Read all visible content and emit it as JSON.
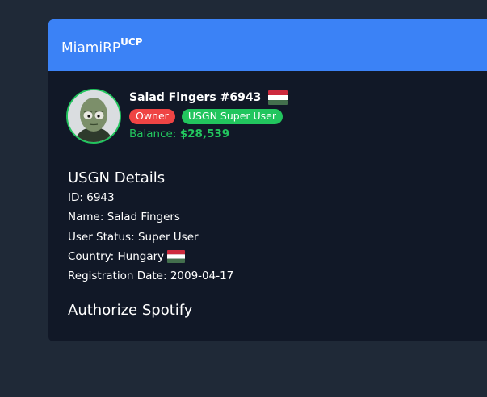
{
  "header": {
    "brand": "MiamiRP",
    "brand_sup": "UCP"
  },
  "profile": {
    "username": "Salad Fingers #6943",
    "flag_icon": "hungary-flag-icon",
    "badges": [
      {
        "label": "Owner",
        "color": "#ef4444"
      },
      {
        "label": "USGN Super User",
        "color": "#22c55e"
      }
    ],
    "balance_label": "Balance:",
    "balance_value": "$28,539"
  },
  "details": {
    "heading": "USGN Details",
    "id_label": "ID:",
    "id_value": "6943",
    "name_label": "Name:",
    "name_value": "Salad Fingers",
    "status_label": "User Status:",
    "status_value": "Super User",
    "country_label": "Country:",
    "country_value": "Hungary",
    "registration_label": "Registration Date:",
    "registration_value": "2009-04-17"
  },
  "spotify": {
    "label": "Authorize Spotify"
  },
  "colors": {
    "page_bg": "#1f2937",
    "card_bg": "#111827",
    "header_bg": "#3b82f6",
    "accent_green": "#22c55e",
    "accent_red": "#ef4444"
  }
}
